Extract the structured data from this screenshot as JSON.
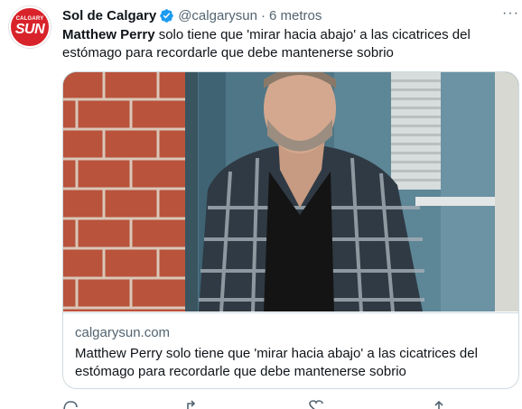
{
  "tweet": {
    "author_name": "Sol de Calgary",
    "handle": "@calgarysun",
    "separator": "·",
    "time": "6 metros",
    "text_bold": "Matthew Perry",
    "text_rest": " solo tiene que 'mirar hacia abajo' a las cicatrices del estómago para recordarle que debe mantenerse sobrio",
    "more_label": "···"
  },
  "avatar": {
    "top_text": "CALGARY",
    "main_text": "SUN",
    "color": "#d8232a"
  },
  "card": {
    "domain": "calgarysun.com",
    "title": "Matthew Perry solo tiene que 'mirar hacia abajo' a las cicatrices del estómago para recordarle que debe mantenerse sobrio"
  },
  "icons": {
    "verified": "verified-badge-icon",
    "more": "more-options-icon",
    "reply": "reply-icon",
    "retweet": "retweet-icon",
    "like": "like-icon",
    "share": "share-icon"
  },
  "colors": {
    "verified_blue": "#1d9bf0",
    "secondary_text": "#536471",
    "border": "#cfd9de"
  }
}
